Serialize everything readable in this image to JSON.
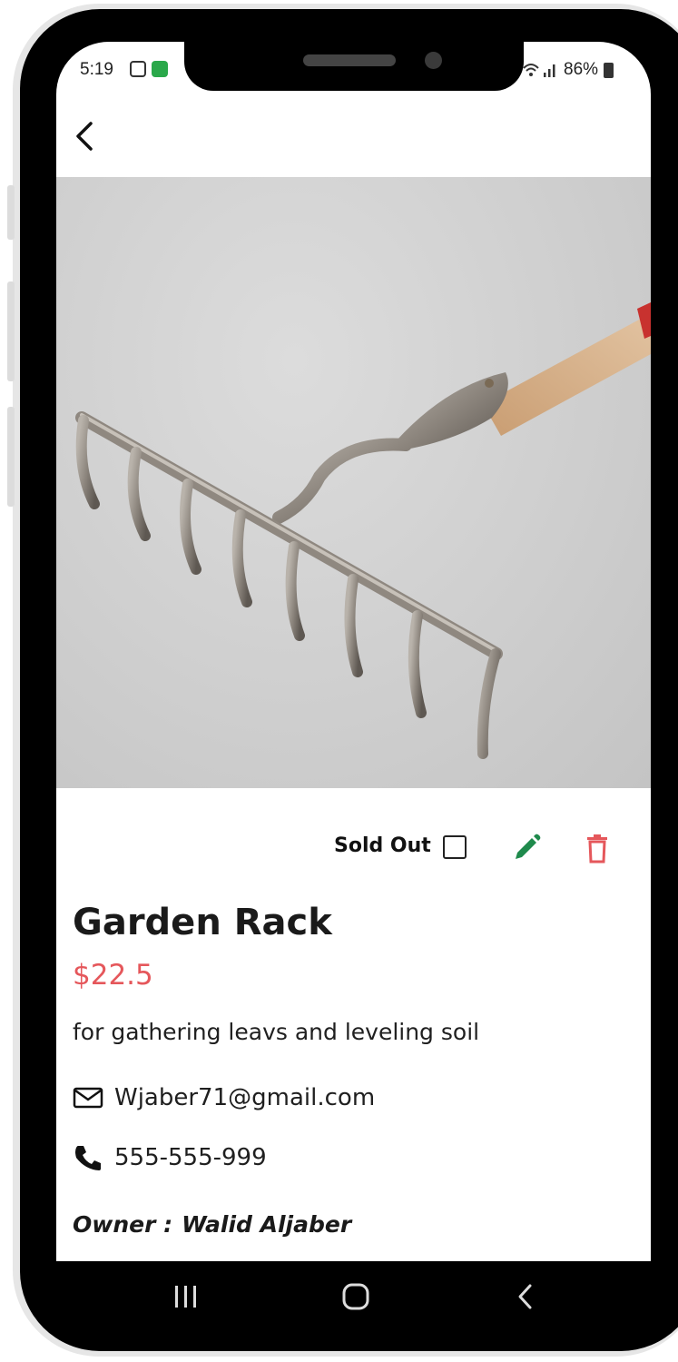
{
  "status_bar": {
    "time": "5:19",
    "battery": "86%"
  },
  "nav": {
    "back_icon": "chevron-left-icon"
  },
  "product": {
    "title": "Garden Rack",
    "price": "$22.5",
    "description": "for gathering leavs and leveling soil",
    "email": "Wjaber71@gmail.com",
    "phone": "555-555-999",
    "owner_label": "Owner :",
    "owner_name": "Walid Aljaber"
  },
  "actions": {
    "sold_out_label": "Sold Out",
    "sold_out_checked": false,
    "edit_icon": "pencil-icon",
    "delete_icon": "trash-icon"
  },
  "colors": {
    "price": "#e5575b",
    "edit": "#1f8a4c",
    "delete": "#e5575b"
  },
  "system_nav": {
    "recents_icon": "recents-icon",
    "home_icon": "home-icon",
    "back_icon": "back-icon"
  }
}
